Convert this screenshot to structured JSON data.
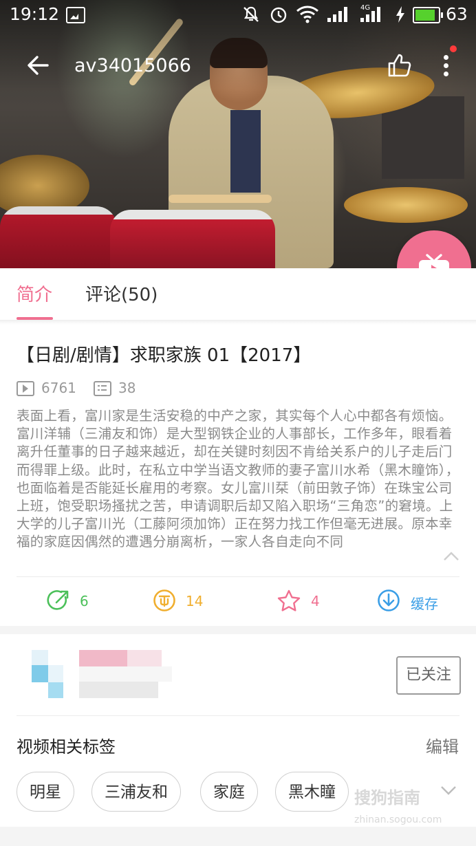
{
  "status_bar": {
    "time": "19:12",
    "network": "4G",
    "battery": "63",
    "battery_color": "#56d12d"
  },
  "header": {
    "video_id": "av34015066",
    "icons": [
      "back-icon",
      "thumbs-up-icon",
      "more-icon",
      "tv-icon"
    ]
  },
  "tabs": [
    {
      "label": "简介",
      "active": true
    },
    {
      "label": "评论(50)",
      "active": false
    }
  ],
  "accent_color": "#f06f90",
  "video": {
    "title": "【日剧/剧情】求职家族 01【2017】",
    "play_count": "6761",
    "danmaku_count": "38",
    "description": "表面上看，富川家是生活安稳的中产之家，其实每个人心中都各有烦恼。富川洋辅（三浦友和饰）是大型钢铁企业的人事部长，工作多年，眼看着离升任董事的日子越来越近，却在关键时刻因不肯给关系户的儿子走后门而得罪上级。此时，在私立中学当语文教师的妻子富川水希（黑木瞳饰），也面临着是否能延长雇用的考察。女儿富川栞（前田敦子饰）在珠宝公司上班，饱受职场搔扰之苦，申请调职后却又陷入职场“三角恋”的窘境。上大学的儿子富川光（工藤阿须加饰）正在努力找工作但毫无进展。原本幸福的家庭因偶然的遭遇分崩离析，一家人各自走向不同"
  },
  "actions": {
    "share_count": "6",
    "coin_count": "14",
    "favorite_count": "4",
    "cache_label": "缓存",
    "colors": {
      "share": "#4cc05a",
      "coin": "#f0ae2e",
      "favorite": "#f06f90",
      "cache": "#3a9ee6"
    }
  },
  "uploader": {
    "follow_label": "已关注"
  },
  "tags_section": {
    "title": "视频相关标签",
    "edit_label": "编辑",
    "tags": [
      "明星",
      "三浦友和",
      "家庭",
      "黑木瞳"
    ]
  },
  "watermark": {
    "text": "搜狗指南",
    "sub": "zhinan.sogou.com"
  }
}
